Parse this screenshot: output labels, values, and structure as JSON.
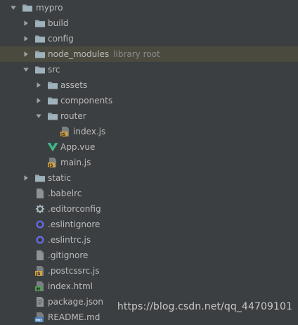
{
  "tree": {
    "root": {
      "label": "mypro"
    },
    "build": {
      "label": "build"
    },
    "config": {
      "label": "config"
    },
    "node_modules": {
      "label": "node_modules",
      "hint": "library root"
    },
    "src": {
      "label": "src"
    },
    "assets": {
      "label": "assets"
    },
    "components": {
      "label": "components"
    },
    "router": {
      "label": "router"
    },
    "router_index": {
      "label": "index.js",
      "icon": "js-file-icon"
    },
    "app_vue": {
      "label": "App.vue",
      "icon": "vue-icon"
    },
    "main_js": {
      "label": "main.js",
      "icon": "js-file-icon"
    },
    "static": {
      "label": "static"
    },
    "babelrc": {
      "label": ".babelrc",
      "icon": "generic-file-icon"
    },
    "editorconfig": {
      "label": ".editorconfig",
      "icon": "gear-icon"
    },
    "eslintignore": {
      "label": ".eslintignore",
      "icon": "eslint-icon"
    },
    "eslintrc": {
      "label": ".eslintrc.js",
      "icon": "eslint-icon"
    },
    "gitignore": {
      "label": ".gitignore",
      "icon": "generic-file-icon"
    },
    "postcssrc": {
      "label": ".postcssrc.js",
      "icon": "js-file-icon"
    },
    "index_html": {
      "label": "index.html",
      "icon": "html-file-icon"
    },
    "package_json": {
      "label": "package.json",
      "icon": "json-file-icon"
    },
    "readme": {
      "label": "README.md",
      "icon": "markdown-file-icon"
    }
  },
  "watermark": "https://blog.csdn.net/qq_44709101",
  "colors": {
    "background": "#3c3f41",
    "highlight_row": "#4b4a3f",
    "folder": "#90a4ae",
    "js_badge": "#d9a53b",
    "vue_green": "#41b883",
    "eslint_purple": "#6b6cf6"
  }
}
